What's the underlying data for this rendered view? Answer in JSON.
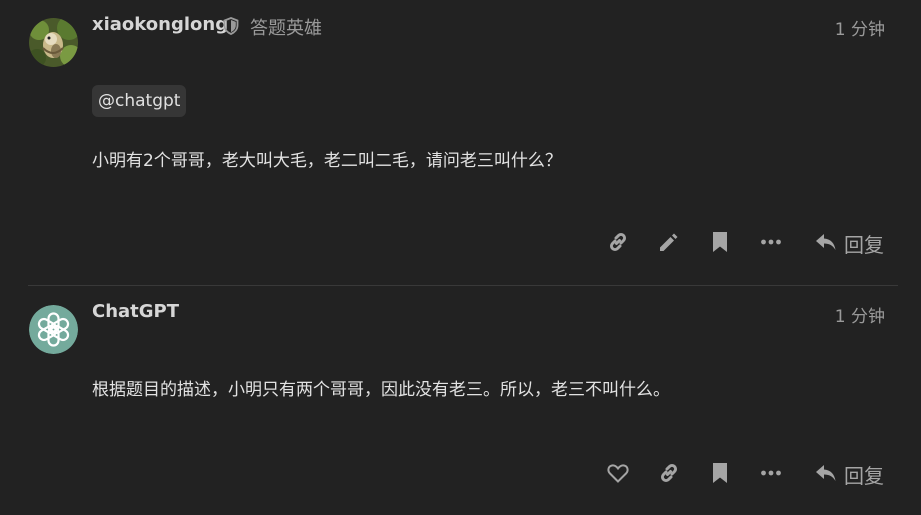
{
  "posts": [
    {
      "username": "xiaokonglong",
      "user_title": "答题英雄",
      "time": "1 分钟",
      "mention": "@chatgpt",
      "body": "小明有2个哥哥，老大叫大毛，老二叫二毛，请问老三叫什么？",
      "actions": [
        "link-icon",
        "pencil-icon",
        "bookmark-icon",
        "more-icon"
      ],
      "reply_label": "回复"
    },
    {
      "username": "ChatGPT",
      "time": "1 分钟",
      "body": "根据题目的描述，小明只有两个哥哥，因此没有老三。所以，老三不叫什么。",
      "actions": [
        "heart-icon",
        "link-icon",
        "bookmark-icon",
        "more-icon"
      ],
      "reply_label": "回复"
    }
  ],
  "colors": {
    "background": "#222222",
    "text": "#e2e2e2",
    "muted": "#9a9a9a",
    "icon": "#a5a5a5",
    "chatgpt_avatar": "#74aa9c"
  }
}
